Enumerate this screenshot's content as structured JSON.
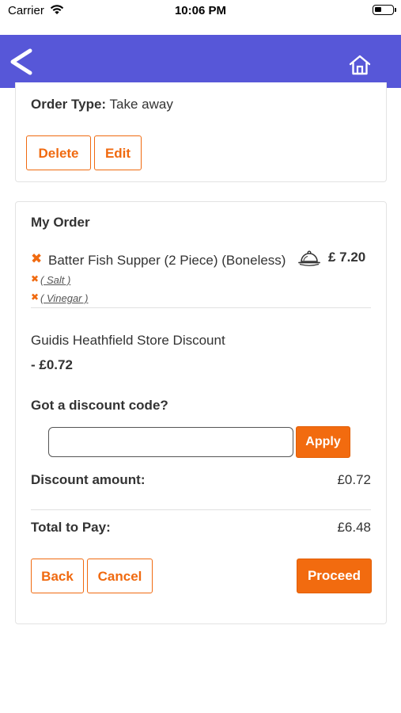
{
  "status_bar": {
    "carrier": "Carrier",
    "time": "10:06 PM"
  },
  "nav": {
    "back_icon": "chevron-left-icon",
    "home_icon": "home-icon",
    "bar_color": "#5757d8"
  },
  "order_info": {
    "order_type_label": "Order Type:",
    "order_type_value": "Take away",
    "delete_label": "Delete",
    "edit_label": "Edit"
  },
  "my_order": {
    "title": "My Order",
    "items": [
      {
        "name": "Batter Fish Supper (2 Piece) (Boneless)",
        "price": "£ 7.20",
        "icon": "cloche-icon",
        "modifiers": [
          "( Salt )",
          "( Vinegar )"
        ]
      }
    ],
    "discount": {
      "name": "Guidis Heathfield Store Discount",
      "value": "- £0.72"
    },
    "discount_code": {
      "prompt": "Got a discount code?",
      "input_value": "",
      "placeholder": "",
      "apply_label": "Apply"
    },
    "summary": {
      "discount_amount_label": "Discount amount:",
      "discount_amount_value": "£0.72",
      "total_label": "Total to Pay:",
      "total_value": "£6.48"
    },
    "actions": {
      "back_label": "Back",
      "cancel_label": "Cancel",
      "proceed_label": "Proceed"
    }
  },
  "colors": {
    "accent": "#f26b0f",
    "nav": "#5757d8",
    "remove_icon": "#f06a10"
  }
}
